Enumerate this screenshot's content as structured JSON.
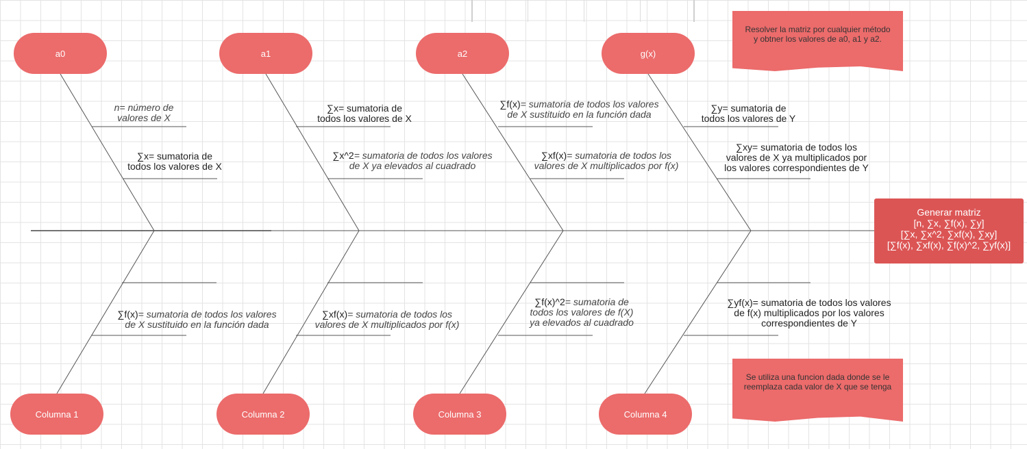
{
  "causes_top": [
    {
      "label": "a0"
    },
    {
      "label": "a1"
    },
    {
      "label": "a2"
    },
    {
      "label": "g(x)"
    }
  ],
  "causes_bottom": [
    {
      "label": "Columna 1"
    },
    {
      "label": "Columna 2"
    },
    {
      "label": "Columna 3"
    },
    {
      "label": "Columna 4"
    }
  ],
  "sub_causes": {
    "a0_1": {
      "sym": "",
      "desc": "n= número de\nvalores de X"
    },
    "a0_2": {
      "sym": "∑x",
      "desc": "= sumatoria de\ntodos los valores de X",
      "plain": true
    },
    "a1_1": {
      "sym": "∑x",
      "desc": "= sumatoria de\ntodos los valores de X",
      "plain": true
    },
    "a1_2": {
      "sym": "∑x^2",
      "desc": "= sumatoria de todos los valores\nde X ya elevados al cuadrado"
    },
    "a2_1": {
      "sym": "∑f(x)",
      "desc": "= sumatoria de todos los valores\nde X sustituido en la función dada"
    },
    "a2_2": {
      "sym": "∑xf(x)",
      "desc": "= sumatoria de todos los\nvalores de X multiplicados por f(x)"
    },
    "gx_1": {
      "sym": "∑y",
      "desc": "= sumatoria de\ntodos los valores de Y",
      "plain": true
    },
    "gx_2": {
      "sym": "∑xy",
      "desc": "= sumatoria de todos los\nvalores de X ya multiplicados por\nlos valores correspondientes de Y",
      "plain": true
    },
    "c1_1": {
      "sym": "∑f(x)",
      "desc": "= sumatoria de todos los valores\nde X sustituido en la función dada"
    },
    "c2_1": {
      "sym": "∑xf(x)",
      "desc": "= sumatoria de todos los\nvalores de X multiplicados por f(x)"
    },
    "c3_1": {
      "sym": "∑f(x)^2",
      "desc": "= sumatoria de\ntodos los valores de f(X)\nya elevados al cuadrado"
    },
    "c4_1": {
      "sym": "∑yf(x)",
      "desc": "= sumatoria de todos los valores\nde f(x) multiplicados por los valores\ncorrespondientes de Y",
      "plain": true
    }
  },
  "head": {
    "text": "Generar matriz\n[n, ∑x, ∑f(x), ∑y]\n[∑x, ∑x^2, ∑xf(x), ∑xy]\n[∑f(x), ∑xf(x), ∑f(x)^2, ∑yf(x)]"
  },
  "notes": {
    "top": "Resolver la matriz por cualquier método\ny obtner los valores de a0, a1 y a2.",
    "bottom": "Se utiliza una funcion dada donde se le\nreemplaza cada valor de X que se tenga"
  },
  "colors": {
    "pill": "#ec6b6b",
    "head": "#dc5555",
    "line": "#555555"
  }
}
